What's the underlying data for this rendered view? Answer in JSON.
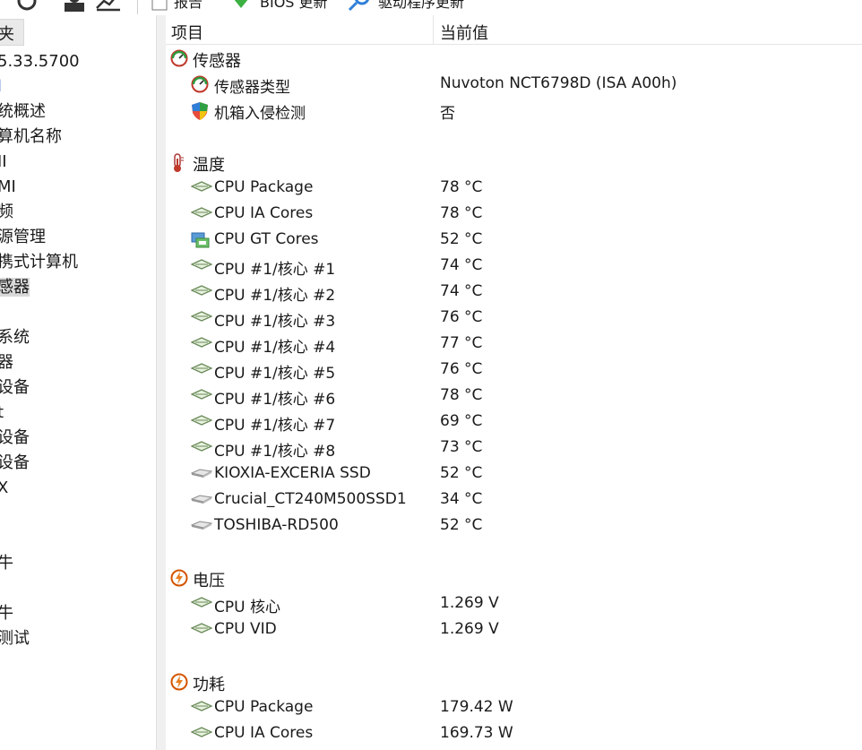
{
  "toolbar": {
    "report_label": "报告",
    "bios_label": "BIOS 更新",
    "driver_label": "驱动程序更新"
  },
  "tree": {
    "header": "夹",
    "items": [
      {
        "label": "5.33.5700",
        "selected": false,
        "blue": false
      },
      {
        "label": "l",
        "selected": false,
        "blue": true
      },
      {
        "label": "统概述",
        "selected": false,
        "blue": false
      },
      {
        "label": "算机名称",
        "selected": false,
        "blue": false
      },
      {
        "label": "II",
        "selected": false,
        "blue": false
      },
      {
        "label": "MI",
        "selected": false,
        "blue": false
      },
      {
        "label": "频",
        "selected": false,
        "blue": false
      },
      {
        "label": "源管理",
        "selected": false,
        "blue": false
      },
      {
        "label": "携式计算机",
        "selected": false,
        "blue": false
      },
      {
        "label": "感器",
        "selected": true,
        "blue": false
      },
      {
        "label": "",
        "selected": false,
        "blue": false
      },
      {
        "label": "系统",
        "selected": false,
        "blue": false
      },
      {
        "label": "器",
        "selected": false,
        "blue": false
      },
      {
        "label": "设备",
        "selected": false,
        "blue": false
      },
      {
        "label": "t",
        "selected": false,
        "blue": false
      },
      {
        "label": "设备",
        "selected": false,
        "blue": false
      },
      {
        "label": "设备",
        "selected": false,
        "blue": false
      },
      {
        "label": "X",
        "selected": false,
        "blue": false
      },
      {
        "label": "",
        "selected": false,
        "blue": false
      },
      {
        "label": "",
        "selected": false,
        "blue": false
      },
      {
        "label": "牛",
        "selected": false,
        "blue": false
      },
      {
        "label": "",
        "selected": false,
        "blue": false
      },
      {
        "label": "牛",
        "selected": false,
        "blue": false
      },
      {
        "label": "测试",
        "selected": false,
        "blue": false
      }
    ]
  },
  "columns": {
    "item": "项目",
    "value": "当前值"
  },
  "rows": [
    {
      "kind": "group",
      "icon": "gauge-icon",
      "label": "传感器",
      "value": ""
    },
    {
      "kind": "item",
      "icon": "gauge-icon",
      "label": "传感器类型",
      "value": "Nuvoton NCT6798D  (ISA A00h)"
    },
    {
      "kind": "item",
      "icon": "shield-icon",
      "label": "机箱入侵检测",
      "value": "否"
    },
    {
      "kind": "blank"
    },
    {
      "kind": "group",
      "icon": "thermometer-icon",
      "label": "温度",
      "value": ""
    },
    {
      "kind": "item",
      "icon": "chip-icon",
      "label": "CPU Package",
      "value": "78 °C"
    },
    {
      "kind": "item",
      "icon": "chip-icon",
      "label": "CPU IA Cores",
      "value": "78 °C"
    },
    {
      "kind": "item",
      "icon": "gpu-icon",
      "label": "CPU GT Cores",
      "value": "52 °C"
    },
    {
      "kind": "item",
      "icon": "chip-icon",
      "label": "CPU #1/核心 #1",
      "value": "74 °C"
    },
    {
      "kind": "item",
      "icon": "chip-icon",
      "label": "CPU #1/核心 #2",
      "value": "74 °C"
    },
    {
      "kind": "item",
      "icon": "chip-icon",
      "label": "CPU #1/核心 #3",
      "value": "76 °C"
    },
    {
      "kind": "item",
      "icon": "chip-icon",
      "label": "CPU #1/核心 #4",
      "value": "77 °C"
    },
    {
      "kind": "item",
      "icon": "chip-icon",
      "label": "CPU #1/核心 #5",
      "value": "76 °C"
    },
    {
      "kind": "item",
      "icon": "chip-icon",
      "label": "CPU #1/核心 #6",
      "value": "78 °C"
    },
    {
      "kind": "item",
      "icon": "chip-icon",
      "label": "CPU #1/核心 #7",
      "value": "69 °C"
    },
    {
      "kind": "item",
      "icon": "chip-icon",
      "label": "CPU #1/核心 #8",
      "value": "73 °C"
    },
    {
      "kind": "item",
      "icon": "drive-icon",
      "label": "KIOXIA-EXCERIA SSD",
      "value": "52 °C"
    },
    {
      "kind": "item",
      "icon": "drive-icon",
      "label": "Crucial_CT240M500SSD1",
      "value": "34 °C"
    },
    {
      "kind": "item",
      "icon": "drive-icon",
      "label": "TOSHIBA-RD500",
      "value": "52 °C"
    },
    {
      "kind": "blank"
    },
    {
      "kind": "group",
      "icon": "bolt-icon",
      "label": "电压",
      "value": ""
    },
    {
      "kind": "item",
      "icon": "chip-icon",
      "label": "CPU 核心",
      "value": "1.269 V"
    },
    {
      "kind": "item",
      "icon": "chip-icon",
      "label": "CPU VID",
      "value": "1.269 V"
    },
    {
      "kind": "blank"
    },
    {
      "kind": "group",
      "icon": "bolt-icon",
      "label": "功耗",
      "value": ""
    },
    {
      "kind": "item",
      "icon": "chip-icon",
      "label": "CPU Package",
      "value": "179.42 W"
    },
    {
      "kind": "item",
      "icon": "chip-icon",
      "label": "CPU IA Cores",
      "value": "169.73 W"
    }
  ],
  "colors": {
    "accent": "#1e5fbf",
    "selection": "#d9d9d9",
    "gutter": "#f0f0f0"
  }
}
